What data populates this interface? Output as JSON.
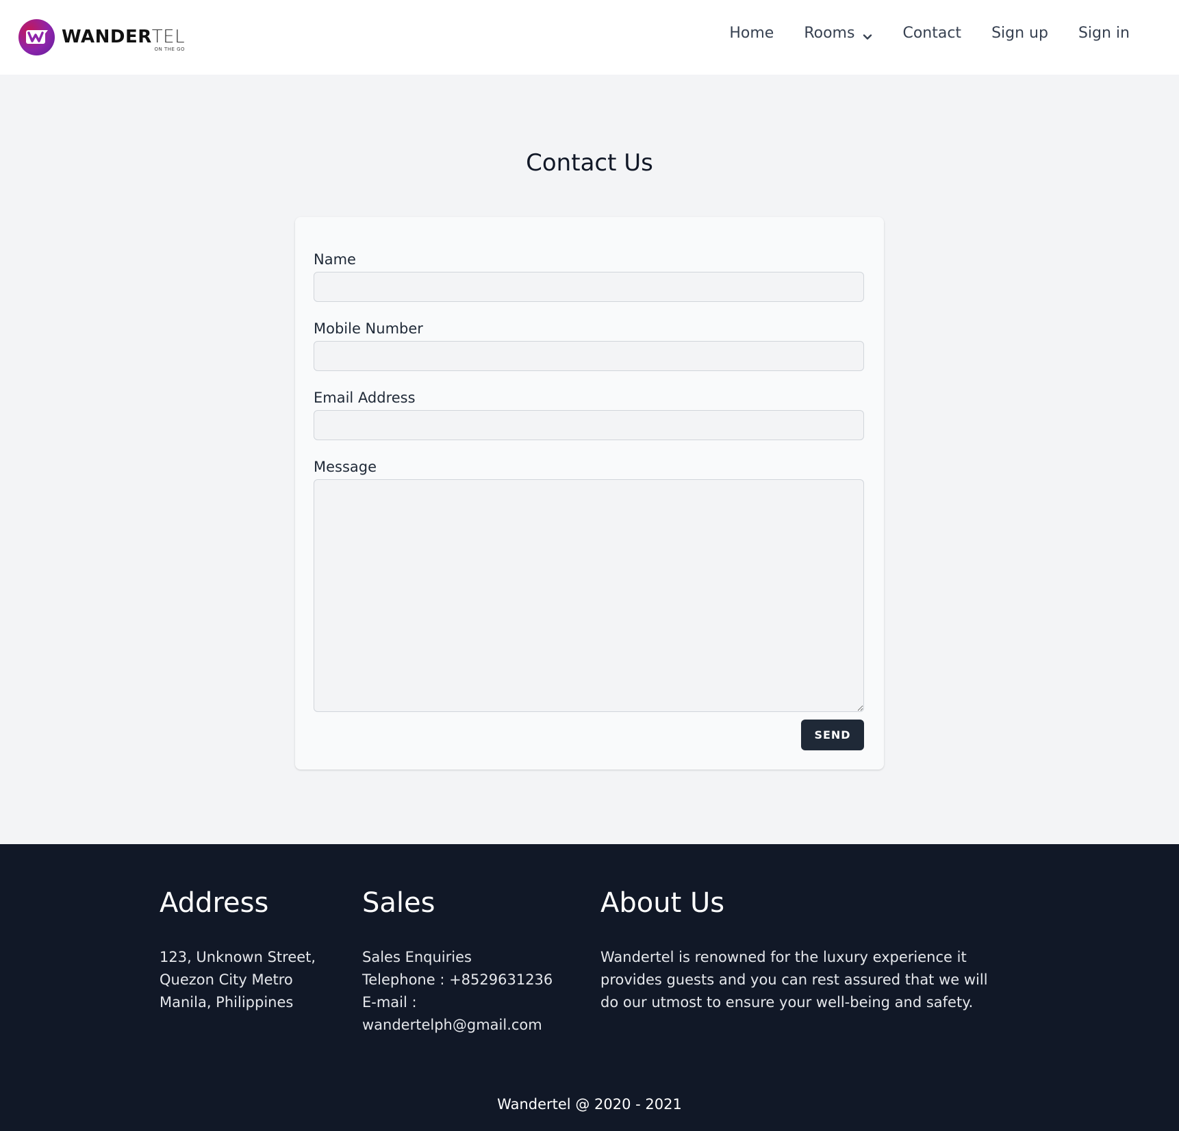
{
  "brand": {
    "name_bold": "WANDER",
    "name_thin": "TEL",
    "tagline": "ON THE GO",
    "colors": {
      "primary": "#8e24aa",
      "secondary": "#c2185b"
    }
  },
  "nav": {
    "items": [
      {
        "label": "Home"
      },
      {
        "label": "Rooms"
      },
      {
        "label": "Contact"
      },
      {
        "label": "Sign up"
      },
      {
        "label": "Sign in"
      }
    ]
  },
  "page": {
    "title": "Contact Us"
  },
  "form": {
    "name_label": "Name",
    "name_value": "",
    "mobile_label": "Mobile Number",
    "mobile_value": "",
    "email_label": "Email Address",
    "email_value": "",
    "message_label": "Message",
    "message_value": "",
    "send_label": "SEND"
  },
  "footer": {
    "address": {
      "heading": "Address",
      "lines": [
        "123, Unknown Street,",
        "Quezon City Metro",
        "Manila, Philippines"
      ]
    },
    "sales": {
      "heading": "Sales",
      "lines": [
        "Sales Enquiries",
        "Telephone : +8529631236",
        "E-mail :",
        "wandertelph@gmail.com"
      ]
    },
    "about": {
      "heading": "About Us",
      "lines": [
        "Wandertel is renowned for the luxury experience it",
        "provides guests and you can rest assured that we will",
        "do our utmost to ensure your well-being and safety."
      ]
    },
    "copyright": "Wandertel @ 2020 - 2021"
  },
  "colors": {
    "page_bg": "#f3f4f6",
    "footer_bg": "#111827",
    "button_bg": "#1f2937"
  }
}
